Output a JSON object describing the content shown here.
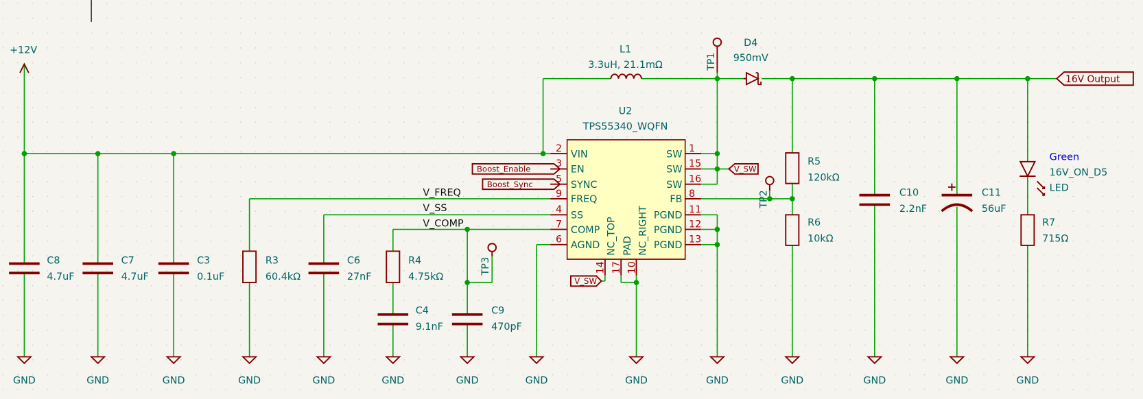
{
  "power": {
    "label": "+12V"
  },
  "gnd_label": "GND",
  "output_label": "16V Output",
  "colors": {
    "wire": "#00a000",
    "component": "#840000",
    "text": "#006464",
    "pin_number": "#a90000",
    "ic_fill": "#ffffc2",
    "background": "#f5f4ef",
    "led_color_text": "#0000c8"
  },
  "components": {
    "C8": {
      "ref": "C8",
      "value": "4.7uF"
    },
    "C7": {
      "ref": "C7",
      "value": "4.7uF"
    },
    "C3": {
      "ref": "C3",
      "value": "0.1uF"
    },
    "R3": {
      "ref": "R3",
      "value": "60.4kΩ"
    },
    "C6": {
      "ref": "C6",
      "value": "27nF"
    },
    "R4": {
      "ref": "R4",
      "value": "4.75kΩ"
    },
    "C4": {
      "ref": "C4",
      "value": "9.1nF"
    },
    "C9": {
      "ref": "C9",
      "value": "470pF"
    },
    "L1": {
      "ref": "L1",
      "value": "3.3uH, 21.1mΩ"
    },
    "D4": {
      "ref": "D4",
      "value": "950mV"
    },
    "R5": {
      "ref": "R5",
      "value": "120kΩ"
    },
    "R6": {
      "ref": "R6",
      "value": "10kΩ"
    },
    "C10": {
      "ref": "C10",
      "value": "2.2nF"
    },
    "C11": {
      "ref": "C11",
      "value": "56uF"
    },
    "D5": {
      "color": "Green",
      "ref": "16V_ON_D5",
      "value": "LED"
    },
    "R7": {
      "ref": "R7",
      "value": "715Ω"
    },
    "TP1": {
      "ref": "TP1"
    },
    "TP2": {
      "ref": "TP2"
    },
    "TP3": {
      "ref": "TP3"
    }
  },
  "u2": {
    "ref": "U2",
    "value": "TPS55340_WQFN",
    "pins_left": [
      {
        "num": "2",
        "name": "VIN"
      },
      {
        "num": "3",
        "name": "EN"
      },
      {
        "num": "5",
        "name": "SYNC"
      },
      {
        "num": "9",
        "name": "FREQ"
      },
      {
        "num": "4",
        "name": "SS"
      },
      {
        "num": "7",
        "name": "COMP"
      },
      {
        "num": "6",
        "name": "AGND"
      }
    ],
    "pins_right": [
      {
        "num": "1",
        "name": "SW"
      },
      {
        "num": "15",
        "name": "SW"
      },
      {
        "num": "16",
        "name": "SW"
      },
      {
        "num": "8",
        "name": "FB"
      },
      {
        "num": "11",
        "name": "PGND"
      },
      {
        "num": "12",
        "name": "PGND"
      },
      {
        "num": "13",
        "name": "PGND"
      }
    ],
    "pins_bottom": [
      {
        "num": "14",
        "name": "NC_TOP"
      },
      {
        "num": "17",
        "name": "PAD"
      },
      {
        "num": "10",
        "name": "NC_RIGHT"
      }
    ]
  },
  "net_labels": {
    "v_freq": "V_FREQ",
    "v_ss": "V_SS",
    "v_comp": "V_COMP",
    "boost_enable": "Boost_Enable",
    "boost_sync": "Boost_Sync",
    "v_sw_right": "V_SW",
    "v_sw_bottom": "V_SW"
  }
}
